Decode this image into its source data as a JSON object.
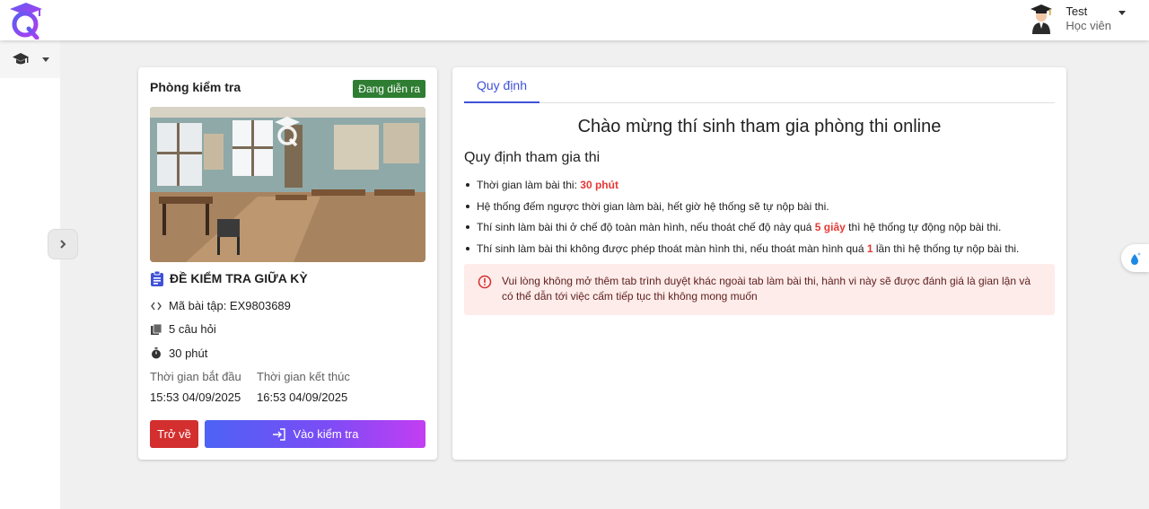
{
  "header": {
    "user_name": "Test",
    "user_role": "Học viên"
  },
  "sidebar": {
    "items": [
      {
        "icon": "graduation-cap-icon"
      }
    ]
  },
  "room": {
    "title": "Phòng kiểm tra",
    "status": "Đang diễn ra",
    "exam_title": "ĐỀ KIỂM TRA GIỮA KỲ",
    "code_label": "Mã bài tập: EX9803689",
    "questions": "5 câu hỏi",
    "duration": "30 phút",
    "start_label": "Thời gian bắt đầu",
    "start_value": "15:53 04/09/2025",
    "end_label": "Thời gian kết thúc",
    "end_value": "16:53 04/09/2025",
    "back_button": "Trở về",
    "enter_button": "Vào kiểm tra"
  },
  "rules": {
    "tab": "Quy định",
    "welcome": "Chào mừng thí sinh tham gia phòng thi online",
    "heading": "Quy định tham gia thi",
    "items": [
      {
        "pre": "Thời gian làm bài thi: ",
        "hl": "30 phút",
        "post": ""
      },
      {
        "pre": "Hệ thống đếm ngược thời gian làm bài, hết giờ hệ thống sẽ tự nộp bài thi.",
        "hl": "",
        "post": ""
      },
      {
        "pre": "Thí sinh làm bài thi ở chế độ toàn màn hình, nếu thoát chế độ này quá ",
        "hl": "5 giây",
        "post": " thì hệ thống tự động nộp bài thi."
      },
      {
        "pre": "Thí sinh làm bài thi không được phép thoát màn hình thi, nếu thoát màn hình quá ",
        "hl": "1",
        "post": " lần thì hệ thống tự nộp bài thi."
      }
    ],
    "alert": "Vui lòng không mở thêm tab trình duyệt khác ngoài tab làm bài thi, hành vi này sẽ được đánh giá là gian lận và có thể dẫn tới việc cấm tiếp tục thi không mong muốn"
  },
  "colors": {
    "accent": "#3f51d8",
    "status_green": "#2e7d32",
    "danger": "#d32f2f",
    "highlight": "#e53935",
    "alert_bg": "#fdecea"
  }
}
